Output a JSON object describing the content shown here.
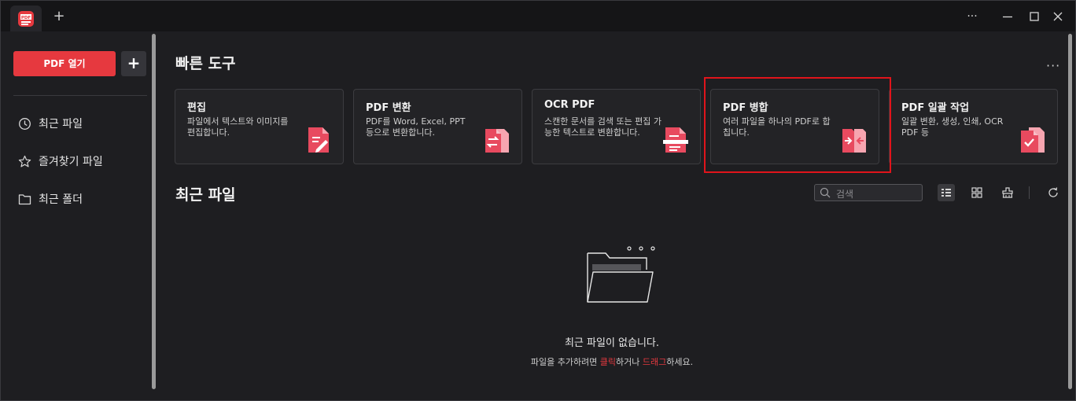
{
  "titlebar": {
    "logo_text": "PDF",
    "new_tab": "+",
    "more": "···",
    "minimize": "—",
    "maximize": "☐",
    "close": "✕"
  },
  "sidebar": {
    "open_pdf": "PDF 열기",
    "add": "+",
    "items": [
      {
        "label": "최근 파일",
        "icon": "clock-icon"
      },
      {
        "label": "즐겨찾기 파일",
        "icon": "star-icon"
      },
      {
        "label": "최근 폴더",
        "icon": "folder-icon"
      }
    ]
  },
  "quick_tools": {
    "title": "빠른 도구",
    "more": "···",
    "cards": [
      {
        "title": "편집",
        "desc": "파일에서 텍스트와 이미지를 편집합니다.",
        "icon": "edit-pdf-icon"
      },
      {
        "title": "PDF 변환",
        "desc": "PDF를 Word, Excel, PPT 등으로 변환합니다.",
        "icon": "convert-pdf-icon"
      },
      {
        "title": "OCR PDF",
        "desc": "스캔한 문서를 검색 또는 편집 가능한 텍스트로 변환합니다.",
        "icon": "ocr-pdf-icon"
      },
      {
        "title": "PDF 병합",
        "desc": "여러 파일을 하나의 PDF로 합칩니다.",
        "icon": "merge-pdf-icon"
      },
      {
        "title": "PDF 일괄 작업",
        "desc": "일괄 변환, 생성, 인쇄, OCR PDF 등",
        "icon": "batch-pdf-icon"
      }
    ]
  },
  "recent": {
    "title": "최근 파일",
    "search_placeholder": "검색",
    "empty_title": "최근 파일이 없습니다.",
    "empty_sub_1": "파일을 추가하려면 ",
    "empty_sub_click": "클릭",
    "empty_sub_2": "하거나 ",
    "empty_sub_drag": "드래그",
    "empty_sub_3": "하세요."
  },
  "colors": {
    "accent": "#e6393f",
    "highlight": "#e0141b",
    "background": "#1e1e21"
  }
}
